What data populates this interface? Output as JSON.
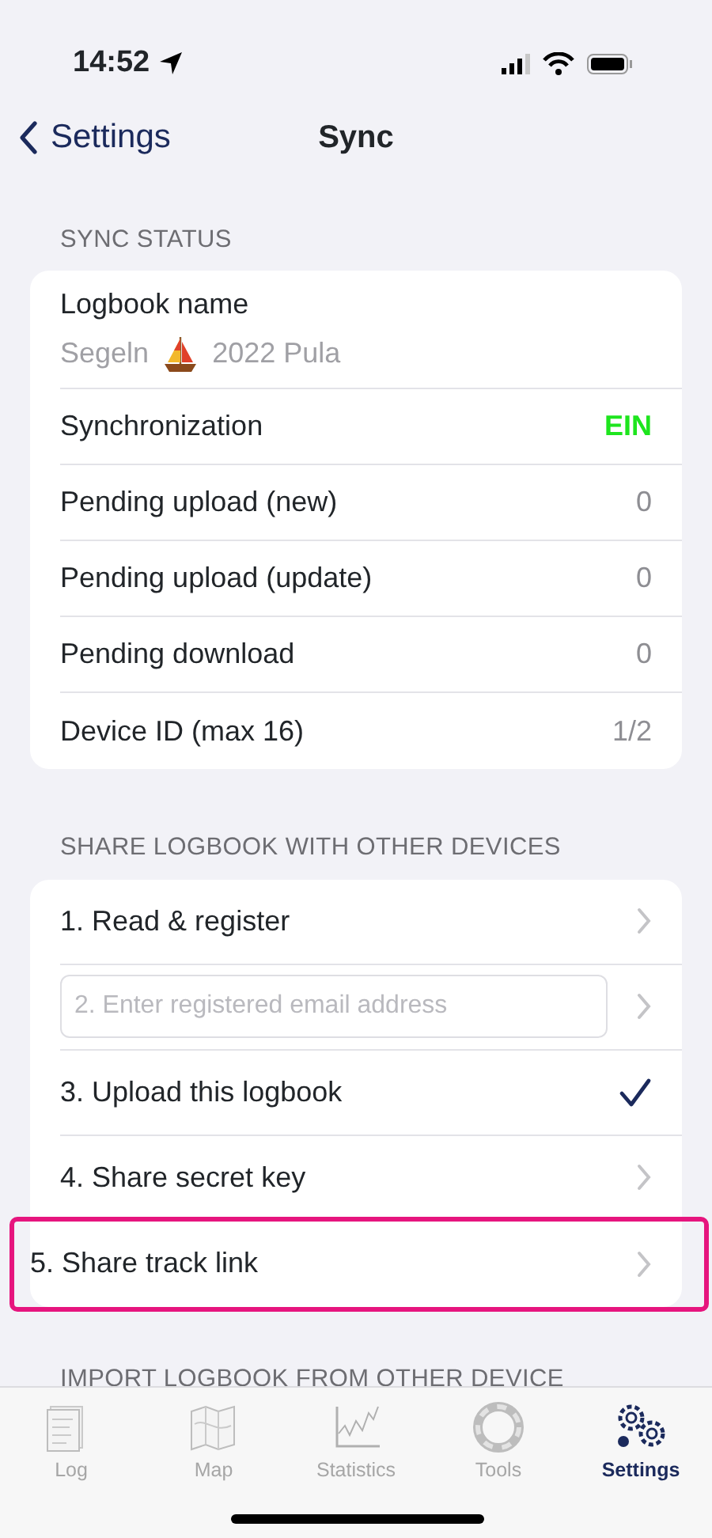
{
  "status_bar": {
    "time": "14:52"
  },
  "nav": {
    "back": "Settings",
    "title": "Sync"
  },
  "sync_status": {
    "header": "SYNC STATUS",
    "logbook": {
      "label": "Logbook name",
      "name_start": "Segeln",
      "name_end": "2022 Pula"
    },
    "rows": [
      {
        "label": "Synchronization",
        "value": "EIN",
        "on": true
      },
      {
        "label": "Pending upload (new)",
        "value": "0"
      },
      {
        "label": "Pending upload (update)",
        "value": "0"
      },
      {
        "label": "Pending download",
        "value": "0"
      },
      {
        "label": "Device ID (max 16)",
        "value": "1/2"
      }
    ]
  },
  "share": {
    "header": "SHARE LOGBOOK WITH OTHER DEVICES",
    "rows": [
      {
        "kind": "link",
        "label": "1. Read & register",
        "highlighted": false
      },
      {
        "kind": "field",
        "placeholder": "2. Enter registered email address",
        "highlighted": false
      },
      {
        "kind": "check",
        "label": "3. Upload this logbook",
        "checked": true,
        "highlighted": false
      },
      {
        "kind": "link",
        "label": "4. Share secret key",
        "highlighted": false
      },
      {
        "kind": "link",
        "label": "5. Share track link",
        "highlighted": true
      }
    ]
  },
  "import_header": "IMPORT LOGBOOK FROM OTHER DEVICE",
  "tab_bar": [
    {
      "label": "Log",
      "selected": false
    },
    {
      "label": "Map",
      "selected": false
    },
    {
      "label": "Statistics",
      "selected": false
    },
    {
      "label": "Tools",
      "selected": false
    },
    {
      "label": "Settings",
      "selected": true
    }
  ]
}
